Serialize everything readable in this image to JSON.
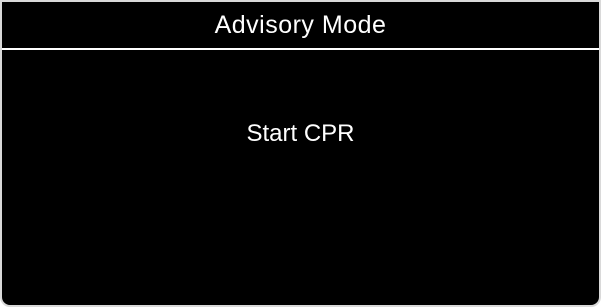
{
  "header": {
    "title": "Advisory Mode"
  },
  "main": {
    "message": "Start CPR"
  },
  "colors": {
    "background": "#000000",
    "text": "#ffffff",
    "frame": "#d9d9d9"
  }
}
